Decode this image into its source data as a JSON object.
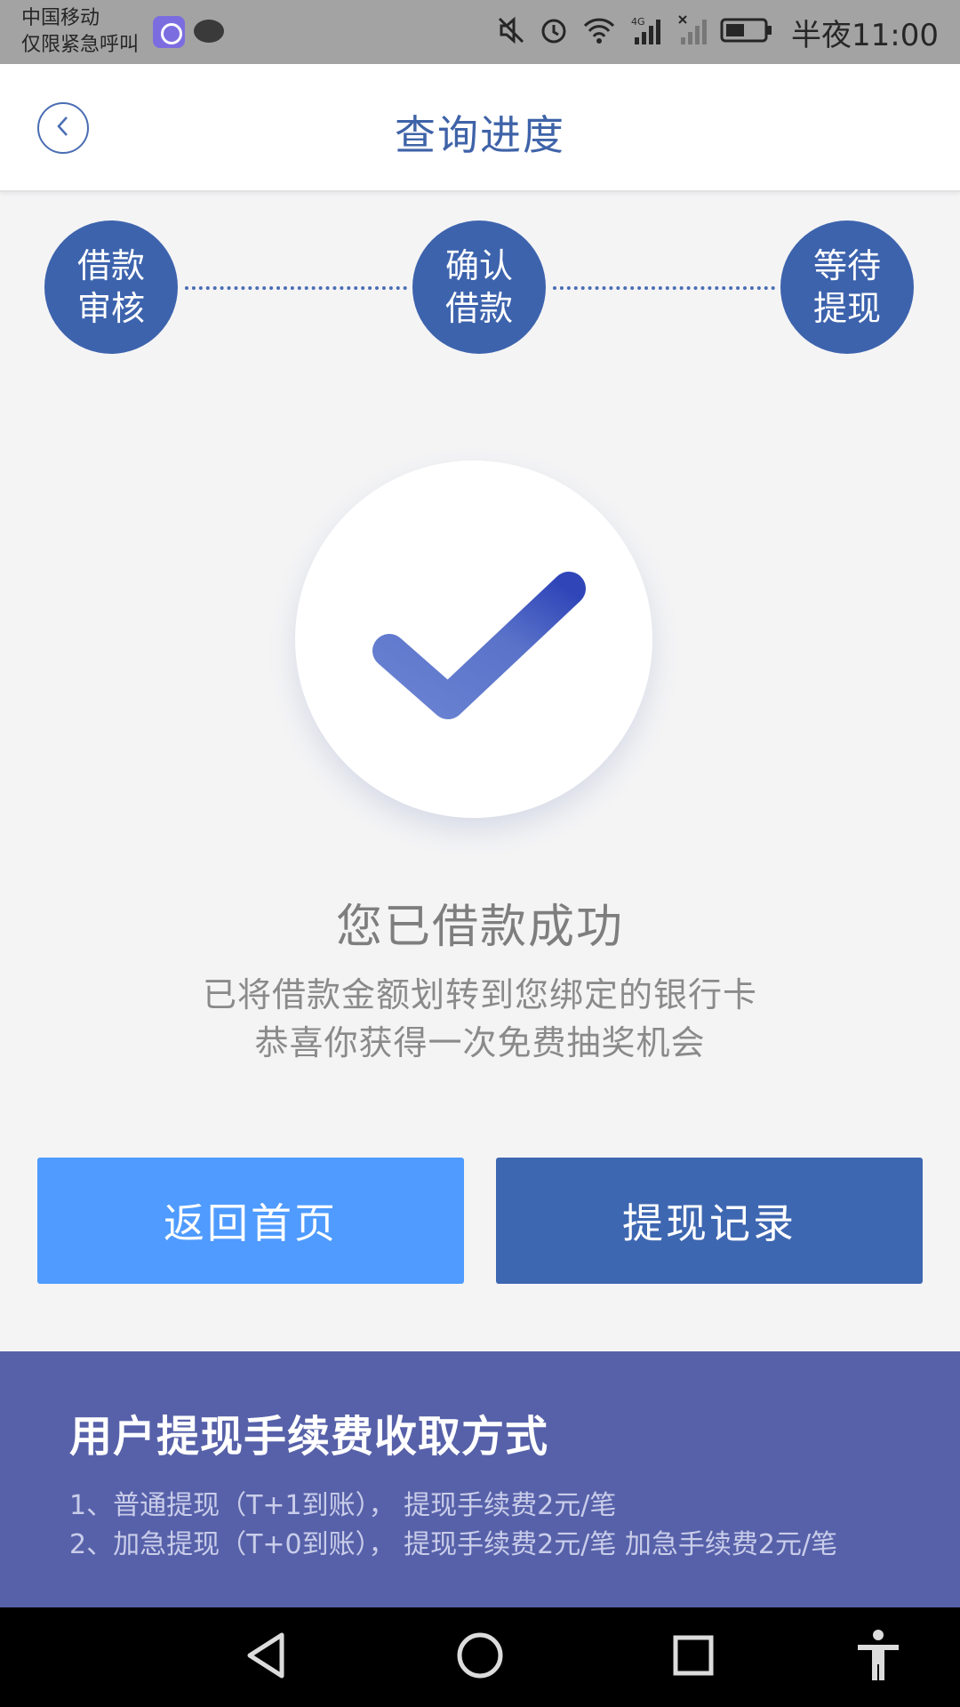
{
  "status_bar": {
    "carrier": "中国移动",
    "emergency": "仅限紧急呼叫",
    "time": "半夜11:00",
    "network": "4G",
    "icons": [
      "app-icon",
      "chat-icon",
      "mute-icon",
      "alarm-icon",
      "wifi-icon",
      "signal-icon",
      "no-signal-icon",
      "battery-icon"
    ]
  },
  "header": {
    "title": "查询进度",
    "back_icon": "chevron-left-icon"
  },
  "steps": [
    {
      "line1": "借款",
      "line2": "审核"
    },
    {
      "line1": "确认",
      "line2": "借款"
    },
    {
      "line1": "等待",
      "line2": "提现"
    }
  ],
  "success": {
    "icon": "checkmark-icon",
    "title": "您已借款成功",
    "line1": "已将借款金额划转到您绑定的银行卡",
    "line2": "恭喜你获得一次免费抽奖机会"
  },
  "buttons": {
    "home": "返回首页",
    "record": "提现记录"
  },
  "fee": {
    "title": "用户提现手续费收取方式",
    "line1": "1、普通提现（T+1到账），  提现手续费2元/笔",
    "line2": "2、加急提现（T+0到账），  提现手续费2元/笔    加急手续费2元/笔"
  },
  "colors": {
    "primary": "#3d63ad",
    "button_light": "#4f9bff",
    "button_dark": "#3e67b1",
    "fee_panel": "#5761a9",
    "background": "#f4f4f5"
  },
  "nav": {
    "icons": [
      "back-triangle-icon",
      "home-circle-icon",
      "recent-square-icon",
      "accessibility-icon"
    ]
  }
}
